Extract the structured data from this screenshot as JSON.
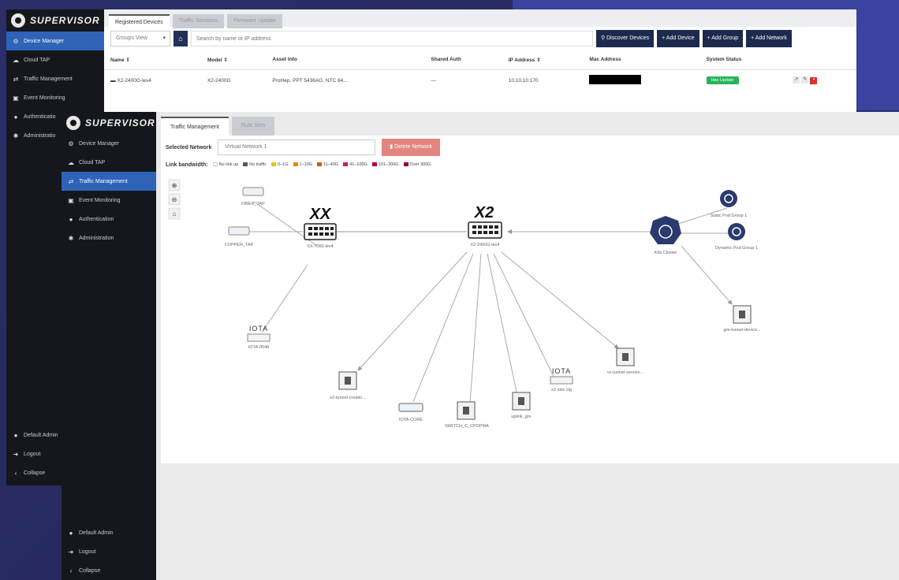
{
  "brand": "SUPERVISOR",
  "back_sidebar": {
    "items": [
      {
        "label": "Device Manager",
        "icon": "gear-icon",
        "active": true
      },
      {
        "label": "Cloud TAP",
        "icon": "cloud-icon"
      },
      {
        "label": "Traffic Management",
        "icon": "traffic-icon"
      },
      {
        "label": "Event Monitoring",
        "icon": "monitor-icon"
      },
      {
        "label": "Authenticatio",
        "icon": "auth-icon"
      },
      {
        "label": "Administratio",
        "icon": "admin-icon"
      }
    ],
    "bottom": [
      {
        "label": "Default Admin",
        "icon": "user-icon"
      },
      {
        "label": "Logout",
        "icon": "logout-icon"
      },
      {
        "label": "Collapse",
        "icon": "collapse-icon"
      }
    ]
  },
  "back_window": {
    "tabs": [
      "Registered Devices",
      "Traffic Sessions",
      "Firmware Update"
    ],
    "group_select": "Groups View",
    "search_placeholder": "Search by name or IP address",
    "buttons": [
      "Discover Devices",
      "+ Add Device",
      "+ Add Group",
      "+ Add Network"
    ],
    "columns": [
      "Name ⇕",
      "Model ⇕",
      "Asset Info",
      "Shared Auth",
      "IP Address ⇕",
      "Mac Address",
      "System Status"
    ],
    "rows": [
      {
        "name": "X2-2400G-lev4",
        "model": "X2-2400G",
        "asset": "ProHep, PPT 5436AG, NTC 84...",
        "shared": "—",
        "ip": "10.10.10.170",
        "status": "Has Update"
      }
    ]
  },
  "front_sidebar": {
    "items": [
      {
        "label": "Device Manager",
        "icon": "gear-icon"
      },
      {
        "label": "Cloud TAP",
        "icon": "cloud-icon"
      },
      {
        "label": "Traffic Management",
        "icon": "traffic-icon",
        "active": true
      },
      {
        "label": "Event Monitoring",
        "icon": "monitor-icon"
      },
      {
        "label": "Authentication",
        "icon": "auth-icon"
      },
      {
        "label": "Administration",
        "icon": "admin-icon"
      }
    ],
    "bottom": [
      {
        "label": "Default Admin",
        "icon": "user-icon"
      },
      {
        "label": "Logout",
        "icon": "logout-icon"
      },
      {
        "label": "Collapse",
        "icon": "collapse-icon"
      }
    ]
  },
  "front_window": {
    "tabs": [
      "Traffic Management",
      "Rule Sets"
    ],
    "selected_network_label": "Selected Network",
    "selected_network_value": "Virtual Network 1",
    "delete_button": "Delete Network",
    "legend_title": "Link bandwidth:",
    "legend": [
      {
        "label": "No link up",
        "color": "#ffffff"
      },
      {
        "label": "No traffic",
        "color": "#555555"
      },
      {
        "label": "0–1G",
        "color": "#f2c200"
      },
      {
        "label": "1–10G",
        "color": "#e08a00"
      },
      {
        "label": "11–40G",
        "color": "#d85a00"
      },
      {
        "label": "41–100G",
        "color": "#d81b4a"
      },
      {
        "label": "101–300G",
        "color": "#c2002a"
      },
      {
        "label": "Over 300G",
        "color": "#990020"
      }
    ],
    "zoom_icons": [
      "zoom-in-icon",
      "zoom-out-icon",
      "home-icon"
    ],
    "nodes": {
      "fiber_tap": "FIBER_TAP",
      "copper_tap": "COPPER_TAP",
      "iota_brand": "IOTA",
      "iota_1": "IOTA-0048",
      "switch_left": "XX-7060-lev4",
      "switch_center": "X2-2400G-lev4",
      "brand_left": "XX",
      "brand_center": "X2",
      "k8s": "K8s Cluster",
      "static_pod": "Static Pod Group 1",
      "dynamic_pod": "Dynamic Pod Group 1",
      "gre_right": "gre-tunnel-device...",
      "vx_tunnel": "vx-tunnel-service...",
      "x2_tunnel": "x2-tunnel-creatio...",
      "iota_core": "IOTA-CORE",
      "switch_c": "SWITCH_C_CPOPMA",
      "uplink": "uplink_gre",
      "iota_2": "x2-iota-1tg"
    }
  }
}
